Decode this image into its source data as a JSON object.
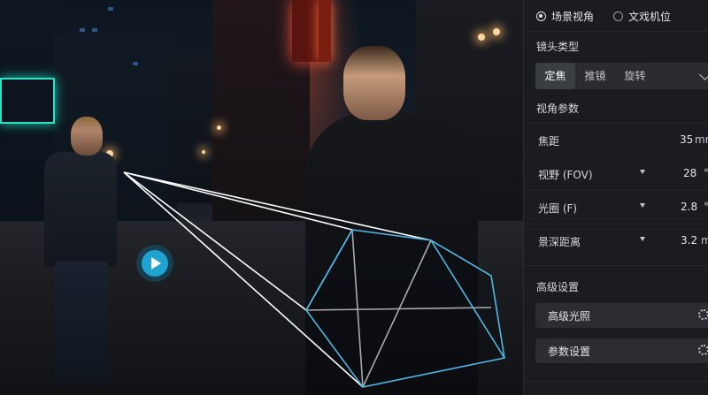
{
  "panel": {
    "modes": [
      {
        "label": "场景视角",
        "selected": true
      },
      {
        "label": "文戏机位",
        "selected": false
      }
    ],
    "lens_type_label": "镜头类型",
    "lens_tabs": [
      {
        "label": "定焦",
        "active": true
      },
      {
        "label": "推镜",
        "active": false
      },
      {
        "label": "旋转",
        "active": false
      }
    ],
    "view_params_label": "视角参数",
    "params": [
      {
        "label": "焦距",
        "value": "35",
        "unit": "mm"
      },
      {
        "label": "视野 (FOV)",
        "value": "28",
        "unit": "°"
      },
      {
        "label": "光圈 (F)",
        "value": "2.8",
        "unit": "°"
      },
      {
        "label": "景深距离",
        "value": "3.2",
        "unit": "m"
      }
    ],
    "advanced_label": "高级设置",
    "advanced_buttons": [
      {
        "label": "高级光照"
      },
      {
        "label": "参数设置"
      }
    ]
  },
  "colors": {
    "accent": "#1fa3d1",
    "frustum_box": "#4fb8e6",
    "panel_bg": "#1b1c1f"
  }
}
